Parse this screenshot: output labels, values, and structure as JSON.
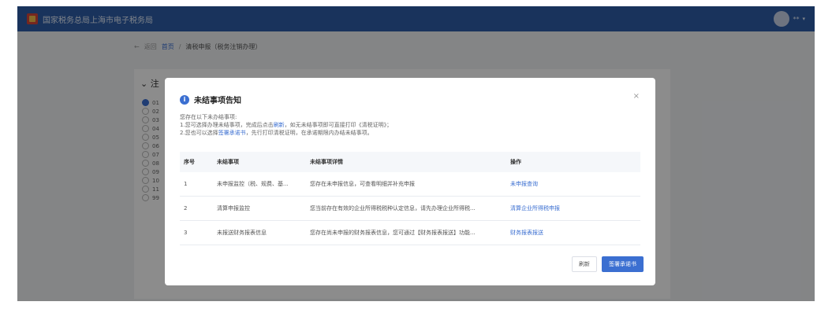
{
  "app": {
    "title": "国家税务总局上海市电子税务局",
    "user": "**"
  },
  "breadcrumb": {
    "back": "返回",
    "home": "首页",
    "current": "清税申报（税务注销办理）"
  },
  "panel": {
    "heading": "注",
    "options": [
      "01",
      "02",
      "03",
      "04",
      "05",
      "06",
      "07",
      "08",
      "09",
      "10",
      "11",
      "99"
    ]
  },
  "modal": {
    "title": "未结事项告知",
    "desc_line1": "您存在以下未办结事项:",
    "desc_line2_pre": "1.您可选择办理未结事项，完成后点击",
    "desc_line2_link": "刷新",
    "desc_line2_post": "，如无未结事项即可直接打印《清税证明》；",
    "desc_line3_pre": "2.您也可以选择",
    "desc_line3_link": "签署承诺书",
    "desc_line3_post": "，先行打印清税证明，在承诺期限内办结未结事项。",
    "columns": [
      "序号",
      "未结事项",
      "未结事项详情",
      "操作"
    ],
    "rows": [
      {
        "no": "1",
        "item": "未申报监控（税、规费、基...",
        "detail": "您存在未申报信息，可查看明细并补充申报",
        "action": "未申报查询"
      },
      {
        "no": "2",
        "item": "清算申报监控",
        "detail": "您当前存在有效的企业所得税税种认定信息，请先办理企业所得税...",
        "action": "清算企业所得税申报"
      },
      {
        "no": "3",
        "item": "未报送财务报表信息",
        "detail": "您存在尚未申报的财务报表信息，您可通过【财务报表报送】功能...",
        "action": "财务报表报送"
      }
    ],
    "refresh_btn": "刷新",
    "sign_btn": "签署承诺书"
  }
}
